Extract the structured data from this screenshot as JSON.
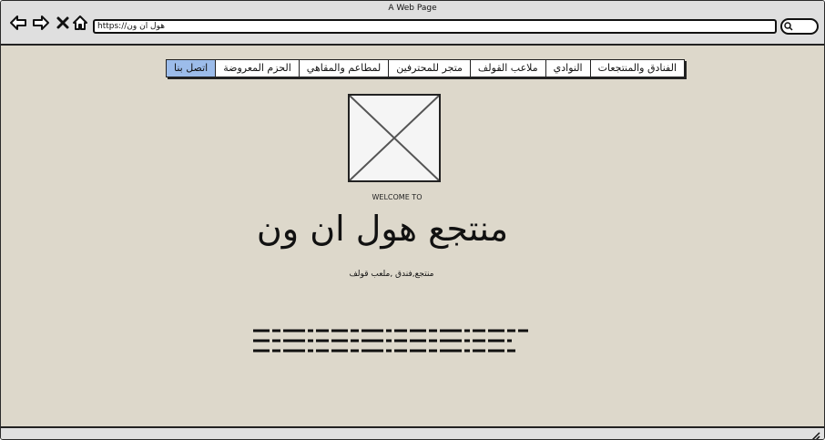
{
  "window": {
    "title": "A Web Page"
  },
  "browser": {
    "address": "https://هول ان ون",
    "icons": [
      "back-arrow-icon",
      "forward-arrow-icon",
      "close-x-icon",
      "home-icon",
      "search-icon"
    ]
  },
  "nav": {
    "tabs": [
      {
        "label": "الفنادق والمنتجعات"
      },
      {
        "label": "النوادي"
      },
      {
        "label": "ملاعب القولف"
      },
      {
        "label": "متجر للمحترفين"
      },
      {
        "label": "لمطاعم والمقاهي"
      },
      {
        "label": "الحزم المعروضة"
      },
      {
        "label": "اتصل بنا"
      }
    ],
    "active_label": "اتصل بنا"
  },
  "hero": {
    "welcome": "WELCOME TO",
    "title": "منتجع هول ان ون",
    "subtitle": "منتجع,فندق ,ملعب قولف"
  },
  "colors": {
    "background": "#ddd8cb",
    "active_tab": "#9cbcea",
    "chrome": "#dfdfdf"
  }
}
